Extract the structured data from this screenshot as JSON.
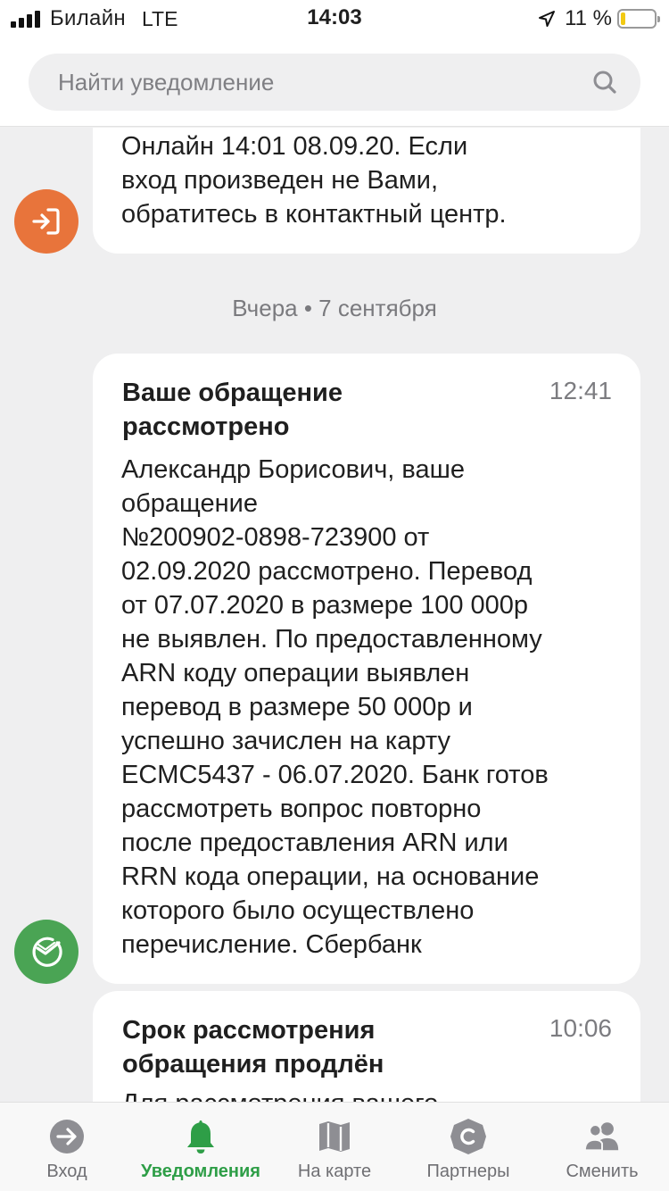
{
  "status_bar": {
    "carrier": "Билайн",
    "network": "LTE",
    "time": "14:03",
    "battery": "11 %",
    "battery_level": 0.11
  },
  "search": {
    "placeholder": "Найти уведомление"
  },
  "notifications": [
    {
      "body": "Онлайн 14:01 08.09.20. Если\nвход произведен не Вами,\nобратитесь в контактный центр.",
      "icon": "login-arrow-icon",
      "icon_color": "#e8743b"
    }
  ],
  "date_separator": "Вчера • 7 сентября",
  "notifications_yesterday": [
    {
      "title": "Ваше обращение\nрассмотрено",
      "time": "12:41",
      "body": "Александр Борисович, ваше\nобращение\n№200902-0898-723900 от\n02.09.2020 рассмотрено. Перевод\nот 07.07.2020 в размере 100 000р\nне выявлен. По предоставленному\nARN коду операции выявлен\nперевод в размере 50 000р и\nуспешно зачислен на карту\nECMC5437 - 06.07.2020. Банк готов\nрассмотреть вопрос повторно\nпосле предоставления ARN или\nRRN кода операции, на основание\nкоторого было осуществлено\nперечисление. Сбербанк",
      "icon": "sberbank-logo-icon",
      "icon_color": "#4aa454"
    },
    {
      "title": "Срок рассмотрения\nобращения продлён",
      "time": "10:06",
      "body": "Для рассмотрения вашего"
    }
  ],
  "tab_bar": {
    "active_color": "#2e9e47",
    "tabs": [
      {
        "label": "Вход",
        "icon": "login-circle-icon"
      },
      {
        "label": "Уведомления",
        "icon": "bell-icon",
        "active": true
      },
      {
        "label": "На карте",
        "icon": "map-icon"
      },
      {
        "label": "Партнеры",
        "icon": "partners-c-icon"
      },
      {
        "label": "Сменить",
        "icon": "users-icon"
      }
    ]
  }
}
